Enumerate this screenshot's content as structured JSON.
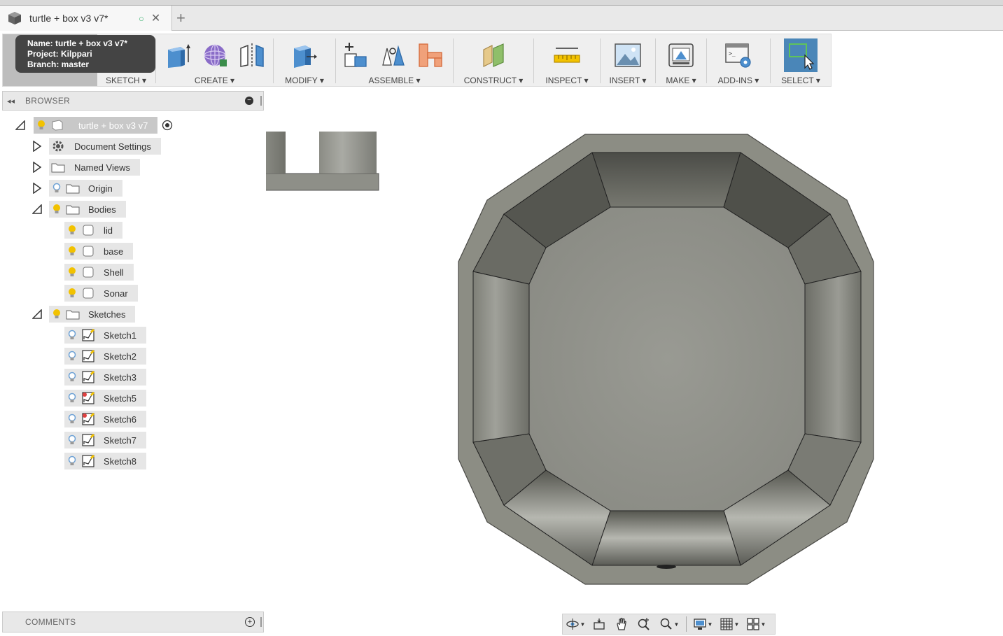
{
  "tab": {
    "title": "turtle + box v3 v7*",
    "sync_status_glyph": "○",
    "close_glyph": "✕",
    "new_tab_glyph": "+"
  },
  "tooltip": {
    "name_line": "Name: turtle + box v3 v7*",
    "project_line": "Project: Kilppari",
    "branch_line": "Branch: master"
  },
  "toolbar": {
    "groups": [
      {
        "label": "SKETCH ▾"
      },
      {
        "label": "CREATE ▾"
      },
      {
        "label": "MODIFY ▾"
      },
      {
        "label": "ASSEMBLE ▾"
      },
      {
        "label": "CONSTRUCT ▾"
      },
      {
        "label": "INSPECT ▾"
      },
      {
        "label": "INSERT ▾"
      },
      {
        "label": "MAKE ▾"
      },
      {
        "label": "ADD-INS ▾"
      },
      {
        "label": "SELECT ▾"
      }
    ]
  },
  "browser": {
    "title": "BROWSER",
    "root": "turtle + box v3 v7",
    "document_settings": "Document Settings",
    "named_views": "Named Views",
    "origin": "Origin",
    "bodies": {
      "label": "Bodies",
      "items": [
        "lid",
        "base",
        "Shell",
        "Sonar"
      ]
    },
    "sketches": {
      "label": "Sketches",
      "items": [
        "Sketch1",
        "Sketch2",
        "Sketch3",
        "Sketch5",
        "Sketch6",
        "Sketch7",
        "Sketch8"
      ]
    }
  },
  "comments": {
    "title": "COMMENTS"
  },
  "colors": {
    "model_face": "#8c8d84",
    "model_wall": "#5f605a",
    "select_active": "#4a86b8",
    "bulb_on": "#f2c200",
    "bulb_off": "#6ea2d6"
  }
}
